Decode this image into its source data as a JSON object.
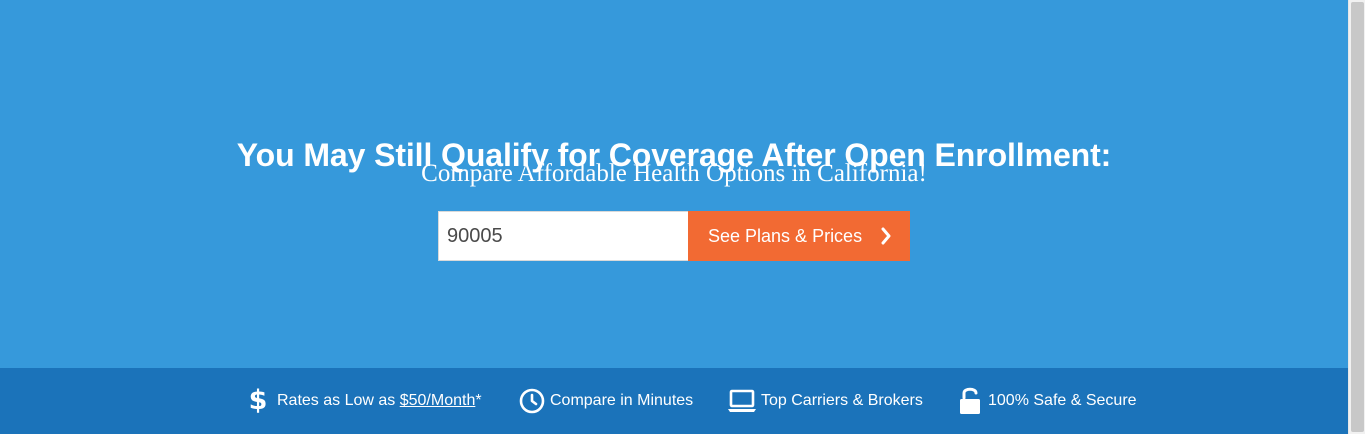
{
  "hero": {
    "title": "You May Still Qualify for Coverage After Open Enrollment:",
    "subtitle": "Compare Affordable Health Options in California!",
    "zip_value": "90005",
    "button_label": "See Plans & Prices",
    "background_color": "#3699db",
    "button_color": "#f26a33"
  },
  "benefits": {
    "background_color": "#1b73ba",
    "items": [
      {
        "icon": "dollar-icon",
        "label_prefix": "Rates as Low as ",
        "link_text": "$50/Month",
        "label_suffix": "*"
      },
      {
        "icon": "clock-icon",
        "label": "Compare in Minutes"
      },
      {
        "icon": "laptop-icon",
        "label": "Top Carriers & Brokers"
      },
      {
        "icon": "unlocked-padlock-icon",
        "label": "100% Safe & Secure"
      }
    ]
  }
}
